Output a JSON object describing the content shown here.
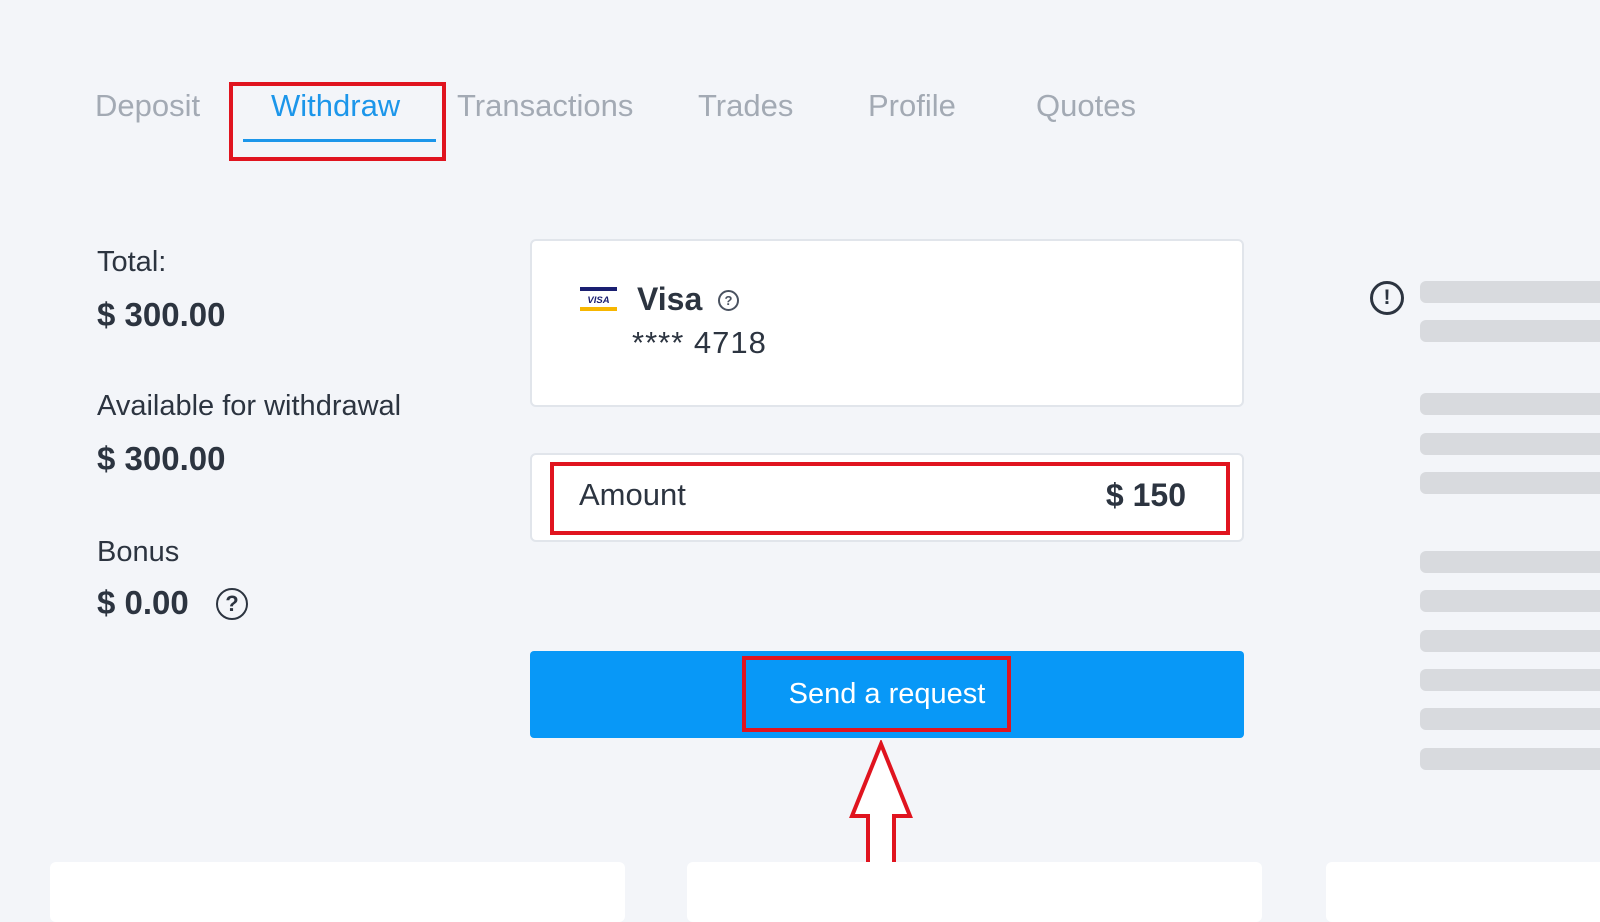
{
  "tabs": [
    {
      "label": "Deposit",
      "active": false
    },
    {
      "label": "Withdraw",
      "active": true
    },
    {
      "label": "Transactions",
      "active": false
    },
    {
      "label": "Trades",
      "active": false
    },
    {
      "label": "Profile",
      "active": false
    },
    {
      "label": "Quotes",
      "active": false
    }
  ],
  "balance": {
    "total_label": "Total:",
    "total_value": "$ 300.00",
    "available_label": "Available for withdrawal",
    "available_value": "$ 300.00",
    "bonus_label": "Bonus",
    "bonus_value": "$ 0.00",
    "help_glyph": "?"
  },
  "card": {
    "logo_text": "VISA",
    "name": "Visa",
    "help_glyph": "?",
    "number": "**** 4718"
  },
  "amount": {
    "label": "Amount",
    "value": "$ 150"
  },
  "send_button": {
    "label": "Send a request"
  },
  "info": {
    "glyph": "!"
  },
  "colors": {
    "accent": "#1c96ea",
    "button": "#0898f7",
    "highlight": "#e0141f",
    "background": "#f3f5f9"
  },
  "icons": [
    "visa-logo-icon",
    "help-icon",
    "info-icon",
    "arrow-up-icon"
  ]
}
